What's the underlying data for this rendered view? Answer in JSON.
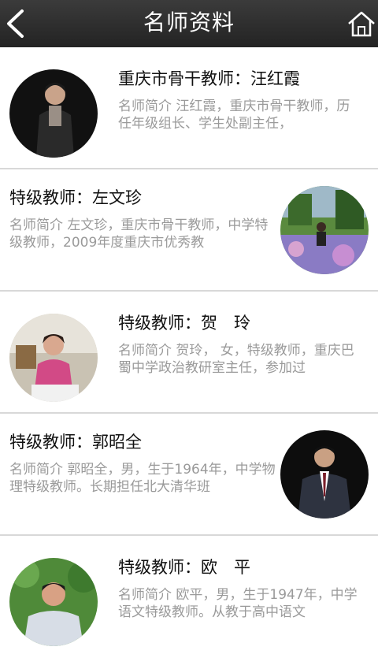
{
  "header": {
    "title": "名师资料",
    "back_icon": "chevron-left-icon",
    "home_icon": "home-icon"
  },
  "teachers": [
    {
      "name": "重庆市骨干教师：汪红霞",
      "intro_label": "名师简介",
      "intro": "汪红霞，重庆市骨干教师，历任年级组长、学生处副主任，",
      "avatar_side": "left"
    },
    {
      "name": "特级教师：左文珍",
      "intro_label": "名师简介",
      "intro": "左文珍，重庆市骨干教师，中学特级教师，2009年度重庆市优秀教",
      "avatar_side": "right"
    },
    {
      "name": "特级教师：贺　玲",
      "intro_label": "名师简介",
      "intro": "贺玲， 女，特级教师，重庆巴蜀中学政治教研室主任，参加过",
      "avatar_side": "left"
    },
    {
      "name": "特级教师：郭昭全",
      "intro_label": "名师简介",
      "intro": "郭昭全，男，生于1964年，中学物理特级教师。长期担任北大清华班",
      "avatar_side": "right"
    },
    {
      "name": "特级教师：欧　平",
      "intro_label": "名师简介",
      "intro": "欧平，男，生于1947年，中学语文特级教师。从教于高中语文",
      "avatar_side": "left"
    }
  ]
}
